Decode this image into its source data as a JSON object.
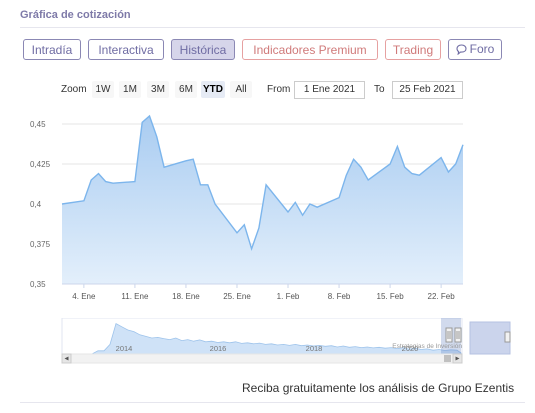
{
  "page_title": "Gráfica de cotización",
  "tabs": [
    {
      "label": "Intradía",
      "active": false
    },
    {
      "label": "Interactiva",
      "active": false
    },
    {
      "label": "Histórica",
      "active": true
    },
    {
      "label": "Indicadores Premium",
      "active": false
    },
    {
      "label": "Trading",
      "active": false
    },
    {
      "label": "Foro",
      "active": false,
      "icon": "chat-bubble-icon"
    }
  ],
  "zoom": {
    "label": "Zoom",
    "buttons": [
      "1W",
      "1M",
      "3M",
      "6M",
      "YTD",
      "All"
    ],
    "active": "YTD"
  },
  "range": {
    "from_label": "From",
    "from_value": "1 Ene 2021",
    "to_label": "To",
    "to_value": "25 Feb 2021"
  },
  "colors": {
    "accent": "#7e7aa8",
    "premium": "#d07a7a",
    "series_line": "#7cb5ec",
    "series_fill_top": "#a9ccf1",
    "series_fill_bottom": "#e3effb"
  },
  "chart_data": {
    "type": "area",
    "title": "",
    "xlabel": "",
    "ylabel": "",
    "x": [
      "1 Ene",
      "4 Ene",
      "5 Ene",
      "6 Ene",
      "7 Ene",
      "8 Ene",
      "11 Ene",
      "12 Ene",
      "13 Ene",
      "14 Ene",
      "15 Ene",
      "18 Ene",
      "19 Ene",
      "20 Ene",
      "21 Ene",
      "22 Ene",
      "25 Ene",
      "26 Ene",
      "27 Ene",
      "28 Ene",
      "29 Ene",
      "1 Feb",
      "2 Feb",
      "3 Feb",
      "4 Feb",
      "5 Feb",
      "8 Feb",
      "9 Feb",
      "10 Feb",
      "11 Feb",
      "12 Feb",
      "15 Feb",
      "16 Feb",
      "17 Feb",
      "18 Feb",
      "19 Feb",
      "22 Feb",
      "23 Feb",
      "24 Feb",
      "25 Feb"
    ],
    "x_positions": [
      -3,
      0,
      1,
      2,
      3,
      4,
      7,
      8,
      9,
      10,
      11,
      14,
      15,
      16,
      17,
      18,
      21,
      22,
      23,
      24,
      25,
      28,
      29,
      30,
      31,
      32,
      35,
      36,
      37,
      38,
      39,
      42,
      43,
      44,
      45,
      46,
      49,
      50,
      51,
      52
    ],
    "series": [
      {
        "values": [
          0.4,
          0.402,
          0.415,
          0.419,
          0.414,
          0.413,
          0.414,
          0.451,
          0.455,
          0.442,
          0.423,
          0.427,
          0.428,
          0.412,
          0.412,
          0.4,
          0.382,
          0.387,
          0.372,
          0.385,
          0.412,
          0.395,
          0.401,
          0.393,
          0.4,
          0.398,
          0.404,
          0.418,
          0.428,
          0.423,
          0.415,
          0.425,
          0.436,
          0.423,
          0.419,
          0.418,
          0.429,
          0.42,
          0.425,
          0.437
        ]
      }
    ],
    "x_ticks": [
      "4. Ene",
      "11. Ene",
      "18. Ene",
      "25. Ene",
      "1. Feb",
      "8. Feb",
      "15. Feb",
      "22. Feb"
    ],
    "x_tick_positions": [
      0,
      7,
      14,
      21,
      28,
      35,
      42,
      49
    ],
    "y_ticks": [
      "0,35",
      "0,375",
      "0,4",
      "0,425",
      "0,45"
    ],
    "y_tick_values": [
      0.35,
      0.375,
      0.4,
      0.425,
      0.45
    ],
    "ylim": [
      0.35,
      0.46
    ],
    "xlim": [
      -3,
      52
    ],
    "grid": true,
    "legend": "none"
  },
  "navigator": {
    "year_labels": [
      "2014",
      "2016",
      "2018",
      "2020"
    ],
    "credit": "Estrategias de Inversión",
    "history": [
      0.1,
      0.1,
      0.3,
      0.95,
      0.85,
      0.75,
      0.7,
      0.6,
      0.55,
      0.5,
      0.52,
      0.48,
      0.45,
      0.5,
      0.42,
      0.45,
      0.4,
      0.44,
      0.38,
      0.4,
      0.36,
      0.38,
      0.35,
      0.38,
      0.33,
      0.35,
      0.32,
      0.34,
      0.3,
      0.32,
      0.28,
      0.3,
      0.27,
      0.3,
      0.26,
      0.28,
      0.25,
      0.27,
      0.24,
      0.26,
      0.22,
      0.25,
      0.21,
      0.23,
      0.2,
      0.22,
      0.19,
      0.21,
      0.18,
      0.2,
      0.17,
      0.2,
      0.15,
      0.18,
      0.14,
      0.16,
      0.12,
      0.14,
      0.11,
      0.13,
      0.12
    ]
  },
  "promo": "Reciba gratuitamente los análisis de Grupo Ezentis"
}
